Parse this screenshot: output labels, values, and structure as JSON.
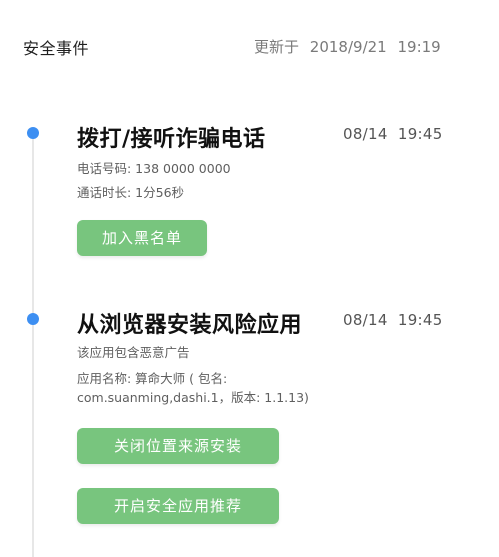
{
  "header": {
    "title": "安全事件",
    "updated_label": "更新于",
    "updated_date": "2018/9/21",
    "updated_time": "19:19"
  },
  "events": [
    {
      "title": "拨打/接听诈骗电话",
      "date": "08/14",
      "time": "19:45",
      "details": [
        "电话号码: 138 0000 0000",
        "通话时长: 1分56秒"
      ],
      "buttons": [
        "加入黑名单"
      ]
    },
    {
      "title": "从浏览器安装风险应用",
      "date": "08/14",
      "time": "19:45",
      "details": [
        "该应用包含恶意广告",
        "应用名称: 算命大师 ( 包名:",
        "com.suanming,dashi.1，版本: 1.1.13)"
      ],
      "buttons": [
        "关闭位置来源安装",
        "开启安全应用推荐"
      ]
    }
  ],
  "colors": {
    "timeline_dot": "#3d8ff2",
    "button_green": "#78c57e",
    "timeline_line": "#e7e7e7"
  }
}
